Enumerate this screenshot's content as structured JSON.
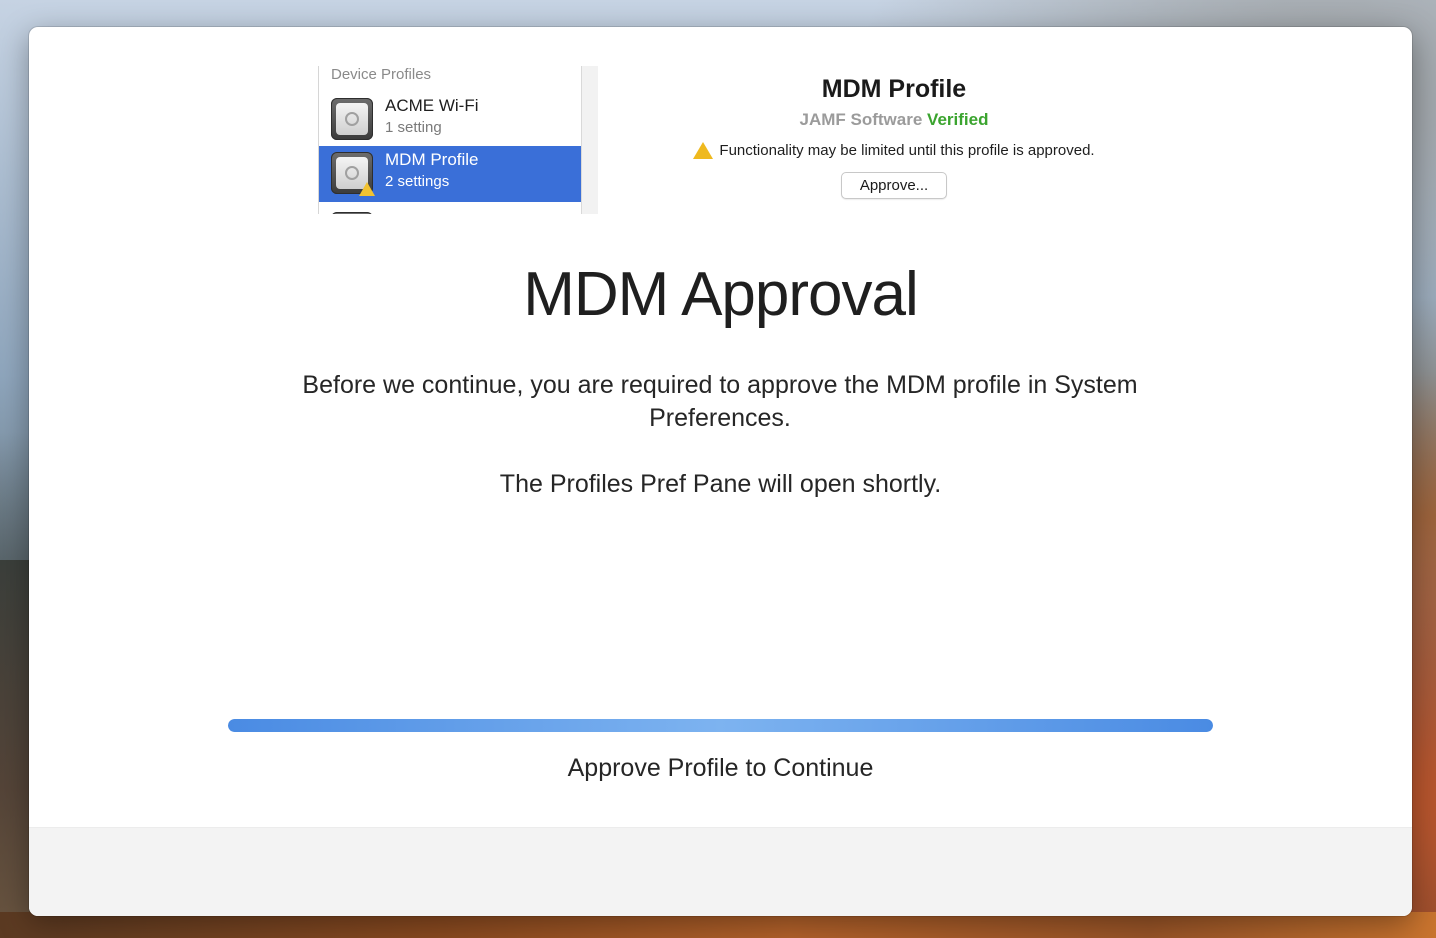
{
  "profiles_list": {
    "header": "Device Profiles",
    "items": [
      {
        "name": "ACME Wi-Fi",
        "detail": "1 setting"
      },
      {
        "name": "MDM Profile",
        "detail": "2 settings"
      }
    ]
  },
  "profile_detail": {
    "title": "MDM Profile",
    "organization": "JAMF Software",
    "verified_label": "Verified",
    "warning": "Functionality may be limited until this profile is approved.",
    "approve_button": "Approve..."
  },
  "main": {
    "title": "MDM Approval",
    "body": "Before we continue, you are required to approve the MDM profile in System Preferences.",
    "note": "The Profiles Pref Pane will open shortly."
  },
  "progress": {
    "fraction": 1.0,
    "status_text": "Approve Profile to Continue"
  },
  "colors": {
    "selection": "#3a6fd8",
    "verified": "#3ba42f",
    "progress": "#4a8be3",
    "warning": "#efb91e"
  },
  "icons": [
    "profile-gear-icon",
    "warning-triangle-icon"
  ]
}
